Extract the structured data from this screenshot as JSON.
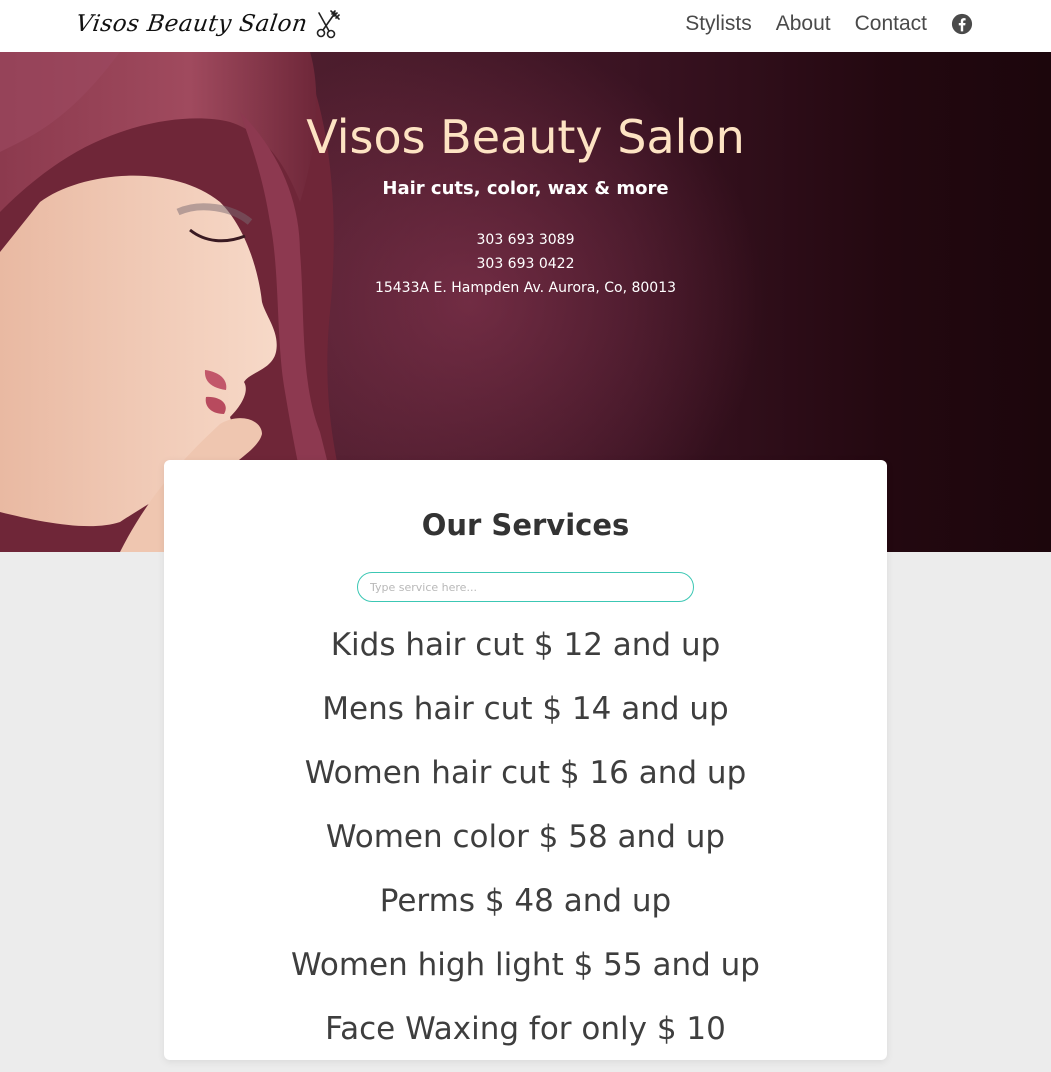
{
  "nav": {
    "brand": "Visos Beauty Salon",
    "brand_icon": "scissors-comb-icon",
    "links": [
      {
        "label": "Stylists"
      },
      {
        "label": "About"
      },
      {
        "label": "Contact"
      }
    ],
    "social_icon": "facebook-icon"
  },
  "hero": {
    "title": "Visos Beauty Salon",
    "subtitle": "Hair cuts, color, wax & more",
    "phone1": "303 693 3089",
    "phone2": "303 693 0422",
    "address": "15433A E. Hampden Av. Aurora, Co, 80013"
  },
  "services": {
    "title": "Our Services",
    "search_placeholder": "Type service here...",
    "items": [
      "Kids hair cut $ 12 and up",
      "Mens hair cut $ 14 and up",
      "Women hair cut $ 16 and up",
      "Women color $ 58 and up",
      "Perms $ 48 and up",
      "Women high light $ 55 and up",
      "Face Waxing for only $ 10"
    ]
  },
  "colors": {
    "accent": "#3cc7b4",
    "hero_title": "#fde3c3",
    "page_bg": "#ececec"
  }
}
